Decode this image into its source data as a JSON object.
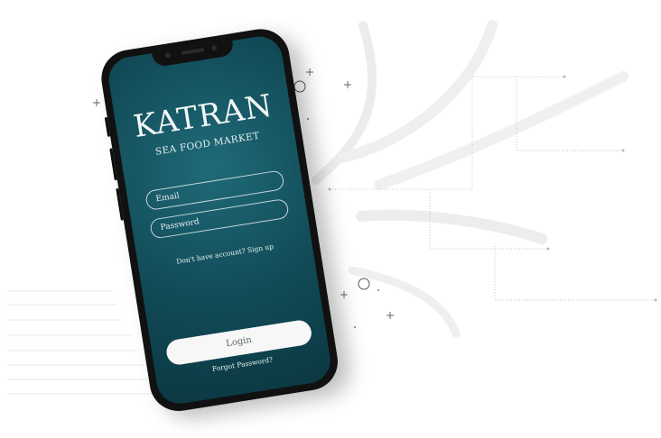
{
  "app": {
    "brand_name": "KATRAN",
    "tagline": "SEA FOOD MARKET"
  },
  "form": {
    "email_placeholder": "Email",
    "password_placeholder": "Password",
    "signup_prompt": "Don't have account? Sign up",
    "login_label": "Login",
    "forgot_label": "Forgot Password?"
  },
  "colors": {
    "screen_primary": "#114a56",
    "button_bg": "#f7f7f7"
  }
}
